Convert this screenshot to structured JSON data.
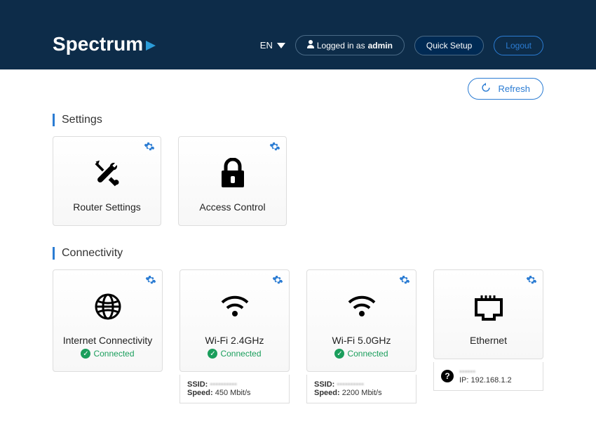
{
  "header": {
    "brand": "Spectrum",
    "language": "EN",
    "logged_in_prefix": "Logged in as ",
    "logged_in_user": "admin",
    "quick_setup": "Quick Setup",
    "logout": "Logout"
  },
  "topbar": {
    "refresh": "Refresh"
  },
  "sections": {
    "settings_title": "Settings",
    "connectivity_title": "Connectivity"
  },
  "settings_cards": {
    "router": "Router Settings",
    "access": "Access Control"
  },
  "connectivity": {
    "internet": {
      "label": "Internet Connectivity",
      "status": "Connected"
    },
    "wifi24": {
      "label": "Wi-Fi 2.4GHz",
      "status": "Connected",
      "ssid_label": "SSID:",
      "ssid_value": "••••••••••",
      "speed_label": "Speed:",
      "speed_value": "450 Mbit/s"
    },
    "wifi50": {
      "label": "Wi-Fi 5.0GHz",
      "status": "Connected",
      "ssid_label": "SSID:",
      "ssid_value": "••••••••••",
      "speed_label": "Speed:",
      "speed_value": "2200 Mbit/s"
    },
    "ethernet": {
      "label": "Ethernet",
      "name": "••••••",
      "ip_label": "IP:",
      "ip_value": "192.168.1.2"
    }
  }
}
